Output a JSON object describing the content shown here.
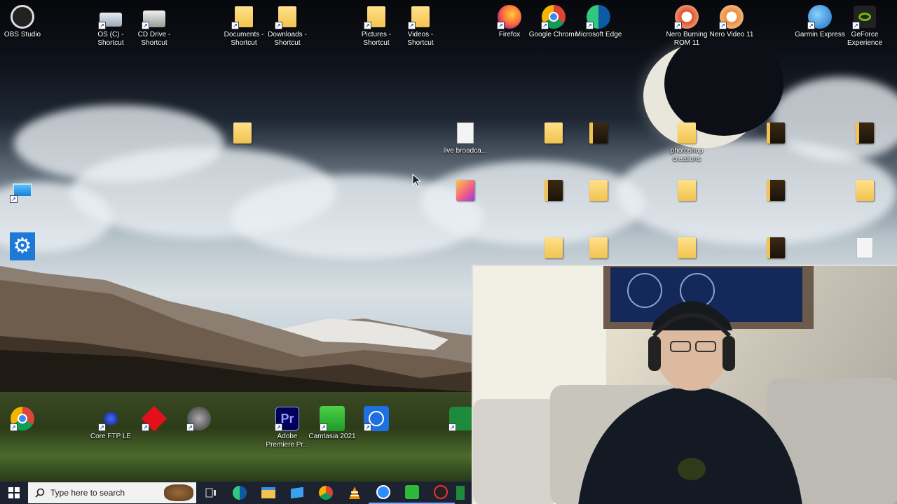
{
  "top_row_icons": [
    {
      "label": "OBS Studio",
      "icon": "obs-icon",
      "shortcut": false
    },
    {
      "label": "OS (C) - Shortcut",
      "icon": "drive-icon",
      "shortcut": true
    },
    {
      "label": "CD Drive - Shortcut",
      "icon": "cd-drive-icon",
      "shortcut": true
    },
    {
      "label": "Documents - Shortcut",
      "icon": "folder-icon",
      "shortcut": true
    },
    {
      "label": "Downloads - Shortcut",
      "icon": "folder-icon",
      "shortcut": true
    },
    {
      "label": "Pictures - Shortcut",
      "icon": "folder-icon",
      "shortcut": true
    },
    {
      "label": "Videos - Shortcut",
      "icon": "folder-icon",
      "shortcut": true
    },
    {
      "label": "Firefox",
      "icon": "firefox-icon",
      "shortcut": true
    },
    {
      "label": "Google Chrome",
      "icon": "chrome-icon",
      "shortcut": true
    },
    {
      "label": "Microsoft Edge",
      "icon": "edge-icon",
      "shortcut": true
    },
    {
      "label": "Nero Burning ROM 11",
      "icon": "nero-icon",
      "shortcut": true
    },
    {
      "label": "Nero Video 11",
      "icon": "nero-icon",
      "shortcut": true
    },
    {
      "label": "Garmin Express",
      "icon": "garmin-icon",
      "shortcut": true
    },
    {
      "label": "GeForce Experience",
      "icon": "nvidia-icon",
      "shortcut": true
    }
  ],
  "mid_icons": [
    {
      "label": "",
      "icon": "folder-icon"
    },
    {
      "label": "live broadca...",
      "icon": "document-icon"
    },
    {
      "label": "",
      "icon": "folder-icon"
    },
    {
      "label": "",
      "icon": "folder-icon"
    },
    {
      "label": "photoshop creations",
      "icon": "folder-icon"
    },
    {
      "label": "",
      "icon": "folder-icon"
    },
    {
      "label": "",
      "icon": "folder-icon"
    },
    {
      "label": "",
      "icon": "folder-icon"
    },
    {
      "label": "",
      "icon": "folder-icon"
    },
    {
      "label": "",
      "icon": "folder-icon"
    },
    {
      "label": "",
      "icon": "folder-icon"
    },
    {
      "label": "",
      "icon": "folder-icon"
    },
    {
      "label": "",
      "icon": "folder-icon"
    }
  ],
  "left_icons": [
    {
      "label": "",
      "icon": "this-pc-icon"
    },
    {
      "label": "",
      "icon": "settings-icon"
    }
  ],
  "bottom_row_icons": [
    {
      "label": "",
      "icon": "chrome-icon"
    },
    {
      "label": "Core FTP LE",
      "icon": "coreftp-icon"
    },
    {
      "label": "",
      "icon": "ytd-icon"
    },
    {
      "label": "",
      "icon": "memorex-icon"
    },
    {
      "label": "Adobe Premiere Pr...",
      "icon": "premiere-icon"
    },
    {
      "label": "Camtasia 2021",
      "icon": "camtasia-icon"
    },
    {
      "label": "",
      "icon": "bible-study-icon"
    },
    {
      "label": "",
      "icon": "swift-icon"
    }
  ],
  "taskbar": {
    "search_placeholder": "Type here to search",
    "icons": [
      "task-view-icon",
      "edge-icon",
      "file-explorer-icon",
      "mail-icon",
      "chrome-icon",
      "vlc-icon",
      "zoom-icon",
      "camtasia-icon",
      "obs-icon",
      "swift-icon"
    ]
  }
}
